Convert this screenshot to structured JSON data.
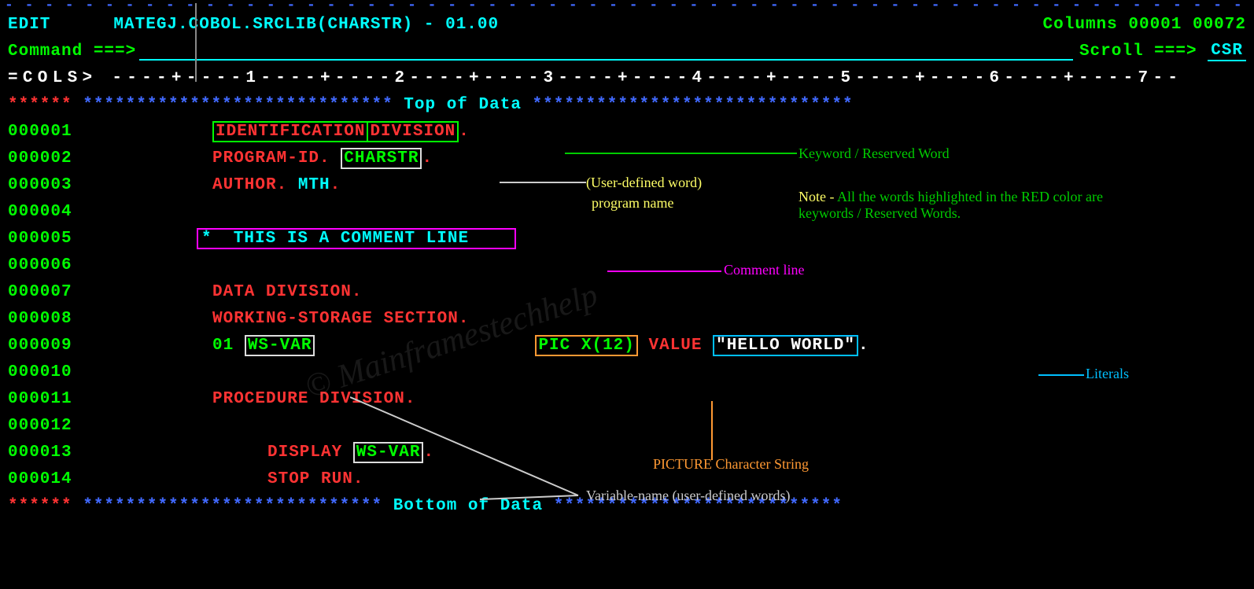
{
  "header": {
    "mode": "EDIT",
    "dataset": "MATEGJ.COBOL.SRCLIB(CHARSTR) - 01.00",
    "columns_label": "Columns 00001 00072"
  },
  "command": {
    "label": "Command ===>",
    "value": "",
    "scroll_label": "Scroll ===>",
    "scroll_value": "CSR"
  },
  "cols_ruler": "=COLS> ----+----1----+----2----+----3----+----4----+----5----+----6----+----7--",
  "top_marker": {
    "stars_left": "******",
    "asterisks": " ***************************** ",
    "label": "Top of Data",
    "asterisks_right": " ******************************"
  },
  "bottom_marker": {
    "stars_left": "******",
    "asterisks": " **************************** ",
    "label": "Bottom of Data",
    "asterisks_right": " ***************************"
  },
  "lines": {
    "l1_seq": "000001",
    "l1_id": "IDENTIFICATION",
    "l1_div": "DIVISION",
    "l1_dot": ".",
    "l2_seq": "000002",
    "l2_pid": "PROGRAM-ID.",
    "l2_name": "CHARSTR",
    "l2_dot": ".",
    "l3_seq": "000003",
    "l3_auth": "AUTHOR.",
    "l3_name": "MTH",
    "l3_dot": ".",
    "l4_seq": "000004",
    "l5_seq": "000005",
    "l5_text": "*  THIS IS A COMMENT LINE",
    "l6_seq": "000006",
    "l7_seq": "000007",
    "l7_text": "DATA DIVISION.",
    "l8_seq": "000008",
    "l8_text": "WORKING-STORAGE SECTION.",
    "l9_seq": "000009",
    "l9_level": "01",
    "l9_var": "WS-VAR",
    "l9_pic": "PIC X(12)",
    "l9_value": "VALUE",
    "l9_lit": "\"HELLO WORLD\"",
    "l9_dot": ".",
    "l10_seq": "000010",
    "l11_seq": "000011",
    "l11_text": "PROCEDURE DIVISION.",
    "l12_seq": "000012",
    "l13_seq": "000013",
    "l13_disp": "DISPLAY",
    "l13_var": "WS-VAR",
    "l13_dot": ".",
    "l14_seq": "000014",
    "l14_text": "STOP RUN."
  },
  "annotations": {
    "keyword": "Keyword / Reserved Word",
    "user_defined1": "(User-defined word)",
    "user_defined2": " program name",
    "note": "Note - ",
    "note_text": "All the words highlighted in the RED color are keywords / Reserved Words.",
    "comment": "Comment line",
    "variable": "Variable-name (user-defined words)",
    "picture": "PICTURE Character String",
    "literals": "Literals"
  },
  "watermark": "© Mainframestechhelp"
}
